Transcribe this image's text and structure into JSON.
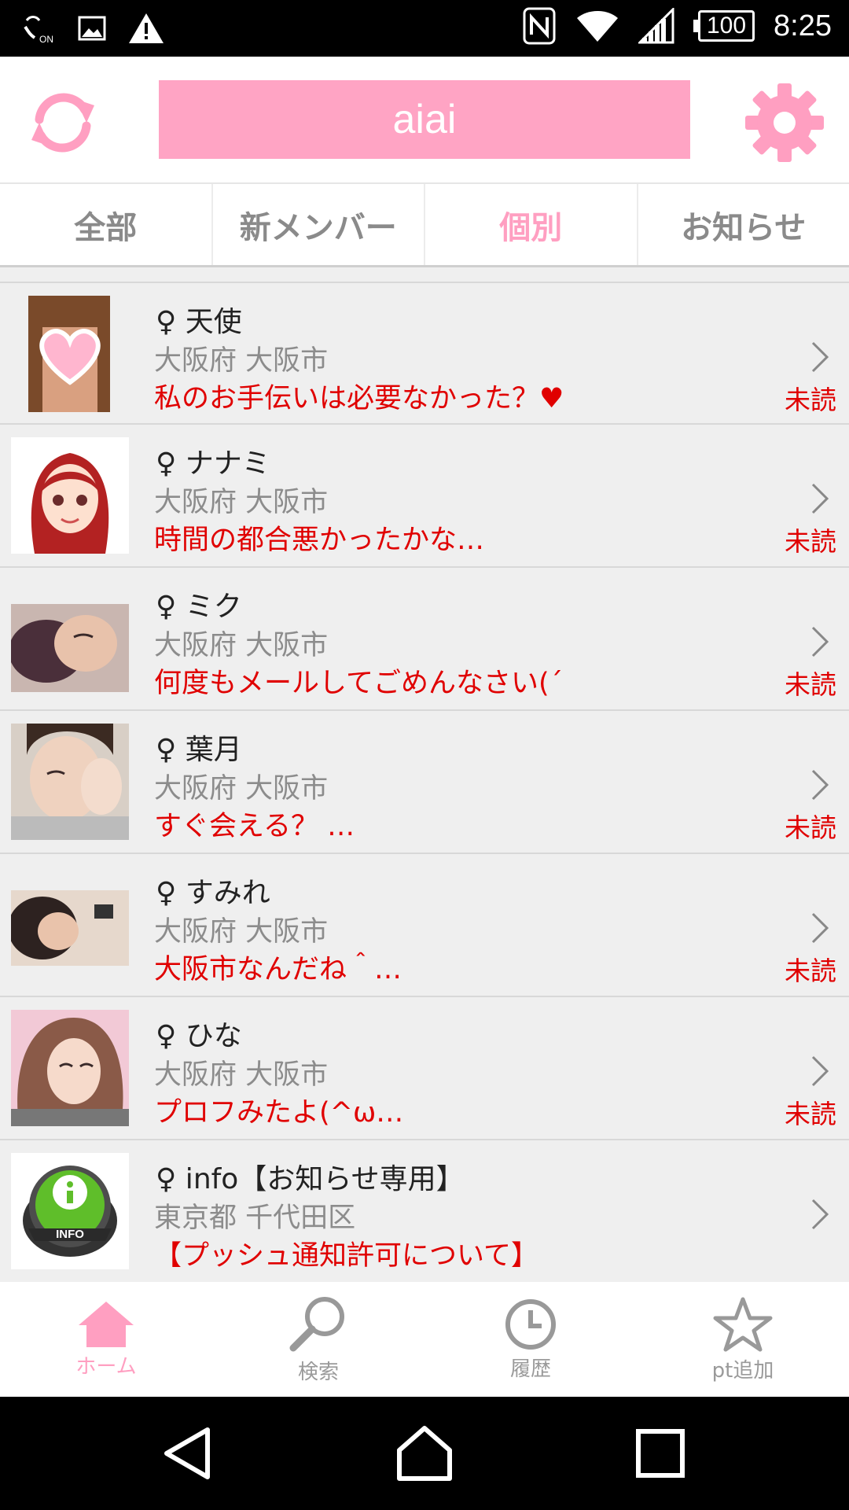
{
  "status_bar": {
    "time": "8:25",
    "battery": "100",
    "icons": [
      "nfc-on-icon",
      "image-icon",
      "warning-icon",
      "nfc-icon",
      "wifi-icon",
      "signal-icon"
    ]
  },
  "header": {
    "title": "aiai",
    "refresh_icon": "refresh-icon",
    "settings_icon": "gear-icon",
    "accent_color": "#ffa4c4"
  },
  "tabs": [
    {
      "label": "全部",
      "active": false
    },
    {
      "label": "新メンバー",
      "active": false
    },
    {
      "label": "個別",
      "active": true
    },
    {
      "label": "お知らせ",
      "active": false
    }
  ],
  "messages": [
    {
      "name": "♀ 天使",
      "location": "大阪府 大阪市",
      "message": "私のお手伝いは必要なかった？♥",
      "status": "未読"
    },
    {
      "name": "♀ ナナミ",
      "location": "大阪府 大阪市",
      "message": "時間の都合悪かったかな…",
      "status": "未読"
    },
    {
      "name": "♀ ミク",
      "location": "大阪府 大阪市",
      "message": "何度もメールしてごめんなさい(´",
      "status": "未読"
    },
    {
      "name": "♀ 葉月",
      "location": "大阪府 大阪市",
      "message": "すぐ会える？ …",
      "status": "未読"
    },
    {
      "name": "♀ すみれ",
      "location": "大阪府 大阪市",
      "message": "大阪市なんだね＾…",
      "status": "未読"
    },
    {
      "name": "♀ ひな",
      "location": "大阪府 大阪市",
      "message": "プロフみたよ(^ω…",
      "status": "未読"
    },
    {
      "name": "♀ info【お知らせ専用】",
      "location": "東京都 千代田区",
      "message": "【プッシュ通知許可について】",
      "status": "",
      "avatar_text": "INFO"
    }
  ],
  "bottom_nav": [
    {
      "label": "ホーム",
      "icon": "home-icon",
      "active": true
    },
    {
      "label": "検索",
      "icon": "search-icon",
      "active": false
    },
    {
      "label": "履歴",
      "icon": "clock-icon",
      "active": false
    },
    {
      "label": "pt追加",
      "icon": "star-icon",
      "active": false
    }
  ],
  "system_nav": [
    "back-icon",
    "home-icon",
    "recents-icon"
  ]
}
